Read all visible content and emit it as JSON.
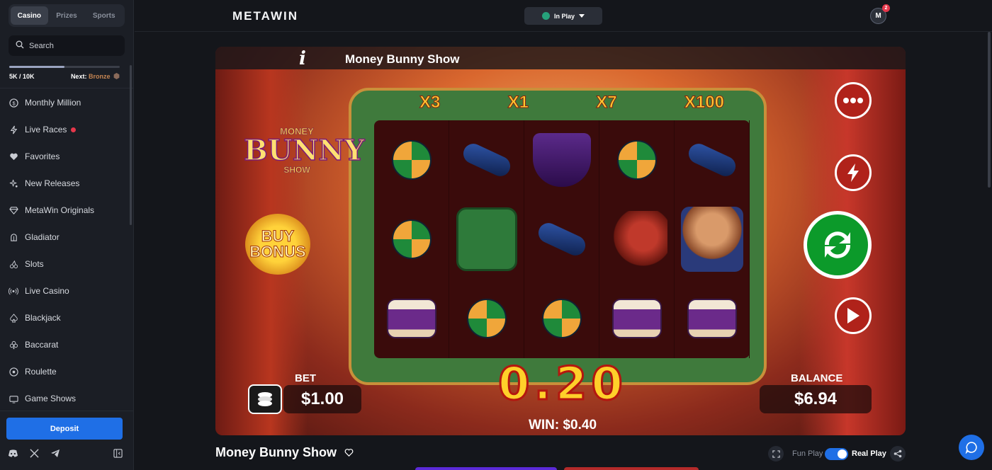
{
  "sidebar": {
    "tabs": [
      {
        "label": "Casino",
        "active": true
      },
      {
        "label": "Prizes",
        "active": false
      },
      {
        "label": "Sports",
        "active": false
      }
    ],
    "search_placeholder": "Search",
    "xp": {
      "progress": "5K / 10K",
      "next_label": "Next:",
      "next_level": "Bronze",
      "progress_fraction": 0.5
    },
    "items": [
      {
        "label": "Monthly Million",
        "icon": "dollar-circle-icon"
      },
      {
        "label": "Live Races",
        "icon": "lightning-icon",
        "live": true
      },
      {
        "label": "Favorites",
        "icon": "heart-icon"
      },
      {
        "label": "New Releases",
        "icon": "sparkle-icon"
      },
      {
        "label": "MetaWin Originals",
        "icon": "diamond-icon"
      },
      {
        "label": "Gladiator",
        "icon": "helmet-icon"
      },
      {
        "label": "Slots",
        "icon": "cherries-icon"
      },
      {
        "label": "Live Casino",
        "icon": "broadcast-icon"
      },
      {
        "label": "Blackjack",
        "icon": "spade-icon"
      },
      {
        "label": "Baccarat",
        "icon": "club-icon"
      },
      {
        "label": "Roulette",
        "icon": "roulette-icon"
      },
      {
        "label": "Game Shows",
        "icon": "tv-icon"
      }
    ],
    "deposit_label": "Deposit"
  },
  "header": {
    "logo": "METAWIN",
    "inplay_label": "In Play",
    "avatar_initial": "M",
    "notifications": "2"
  },
  "game": {
    "title": "Money Bunny Show",
    "multipliers": [
      "X3",
      "X1",
      "X7",
      "X100"
    ],
    "logo_top": "MONEY",
    "logo_main": "BUNNY",
    "logo_sub": "SHOW",
    "buy_bonus": [
      "BUY",
      "BONUS"
    ],
    "bet_label": "BET",
    "bet_value": "$1.00",
    "balance_label": "BALANCE",
    "balance_value": "$6.94",
    "big_win": "0.20",
    "win_line": "WIN: $0.40"
  },
  "footer": {
    "game_title": "Money Bunny Show",
    "fun_play": "Fun Play",
    "real_play": "Real Play",
    "real_play_active": true
  },
  "colors": {
    "accent": "#1f6fe6",
    "sidebar_bg": "#1b1e25",
    "page_bg": "#14161b"
  }
}
